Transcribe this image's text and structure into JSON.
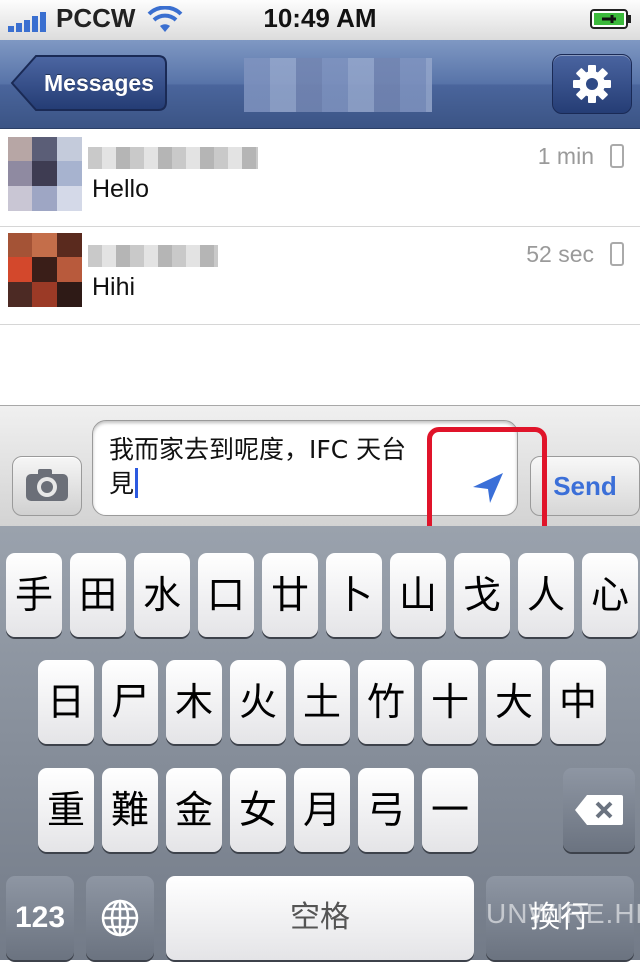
{
  "status_bar": {
    "carrier": "PCCW",
    "time": "10:49 AM",
    "signal_bars": 5,
    "icons": [
      "signal-icon",
      "wifi-icon",
      "battery-charging-icon"
    ]
  },
  "nav": {
    "back_label": "Messages",
    "settings_icon": "gear-icon"
  },
  "messages": [
    {
      "text": "Hello",
      "time": "1 min",
      "device_icon": "phone-icon"
    },
    {
      "text": "Hihi",
      "time": "52 sec",
      "device_icon": "phone-icon"
    }
  ],
  "compose": {
    "text_line1": "我而家去到呢度，IFC 天台",
    "text_line2": "見",
    "send_label": "Send",
    "camera_icon": "camera-icon",
    "location_icon": "location-arrow-icon",
    "highlight_color": "#e0142a"
  },
  "keyboard": {
    "row1": [
      "手",
      "田",
      "水",
      "口",
      "廿",
      "卜",
      "山",
      "戈",
      "人",
      "心"
    ],
    "row2": [
      "日",
      "尸",
      "木",
      "火",
      "土",
      "竹",
      "十",
      "大",
      "中"
    ],
    "row3": [
      "重",
      "難",
      "金",
      "女",
      "月",
      "弓",
      "一"
    ],
    "numbers_label": "123",
    "space_label": "空格",
    "return_label": "換行",
    "globe_icon": "globe-icon",
    "delete_icon": "delete-icon"
  },
  "watermark": "UNWIRE.HK"
}
